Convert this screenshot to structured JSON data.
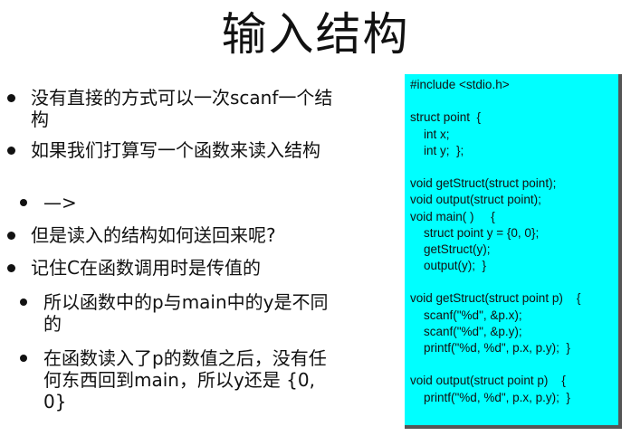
{
  "slide": {
    "title": "输入结构",
    "bullets": [
      {
        "text": "没有直接的方式可以一次scanf一个结构",
        "level": 1
      },
      {
        "text": "如果我们打算写一个函数来读入结构",
        "level": 1
      },
      {
        "text": "—>",
        "level": 2
      },
      {
        "text": "但是读入的结构如何送回来呢?",
        "level": 1
      },
      {
        "text": "记住C在函数调用时是传值的",
        "level": 1
      },
      {
        "text": "所以函数中的p与main中的y是不同的",
        "level": 2
      },
      {
        "text": "在函数读入了p的数值之后，没有任何东西回到main，所以y还是 {0, 0}",
        "level": 2
      }
    ],
    "code_lines": [
      "#include <stdio.h>",
      "",
      "struct point  {",
      "    int x;",
      "    int y;  };",
      "",
      "void getStruct(struct point);",
      "void output(struct point);",
      "void main( )     {",
      "    struct point y = {0, 0};",
      "    getStruct(y);",
      "    output(y);  }",
      "",
      "void getStruct(struct point p)    {",
      "    scanf(\"%d\", &p.x);",
      "    scanf(\"%d\", &p.y);",
      "    printf(\"%d, %d\", p.x, p.y);  }",
      "",
      "void output(struct point p)    {",
      "    printf(\"%d, %d\", p.x, p.y);  }"
    ]
  },
  "colors": {
    "code_background": "#00ffff",
    "code_shadow": "#555555",
    "text": "#111111"
  }
}
